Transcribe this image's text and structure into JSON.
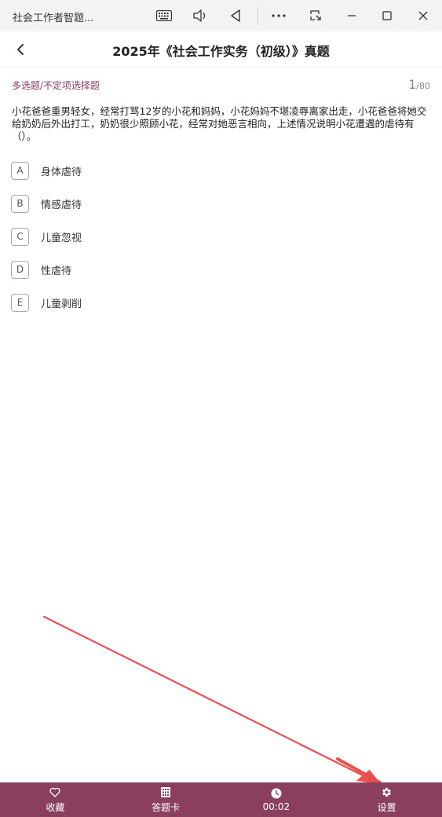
{
  "window": {
    "app_title": "社会工作者智题...",
    "icons": [
      "keyboard-icon",
      "speaker-icon",
      "back-triangle-icon",
      "more-icon",
      "screenshot-icon",
      "minimize-icon",
      "maximize-icon",
      "close-icon"
    ]
  },
  "header": {
    "title": "2025年《社会工作实务（初级）》真题"
  },
  "question": {
    "type": "多选题/不定项选择题",
    "current": "1",
    "total": "/80",
    "text": "小花爸爸重男轻女，经常打骂12岁的小花和妈妈，小花妈妈不堪凌辱离家出走，小花爸爸将她交给奶奶后外出打工，奶奶很少照顾小花，经常对她恶言相向，上述情况说明小花遭遇的虐待有（）。",
    "options": [
      {
        "key": "A",
        "text": "身体虐待"
      },
      {
        "key": "B",
        "text": "情感虐待"
      },
      {
        "key": "C",
        "text": "儿童忽视"
      },
      {
        "key": "D",
        "text": "性虐待"
      },
      {
        "key": "E",
        "text": "儿童剥削"
      }
    ]
  },
  "bottom_bar": {
    "items": [
      {
        "label": "收藏",
        "icon": "heart-icon"
      },
      {
        "label": "答题卡",
        "icon": "grid-icon"
      },
      {
        "label": "00:02",
        "icon": "clock-icon"
      },
      {
        "label": "设置",
        "icon": "gear-icon"
      }
    ],
    "background": "#8b3f5e"
  },
  "colors": {
    "accent": "#8b3f5e",
    "annotation_arrow": "#e8504f"
  }
}
